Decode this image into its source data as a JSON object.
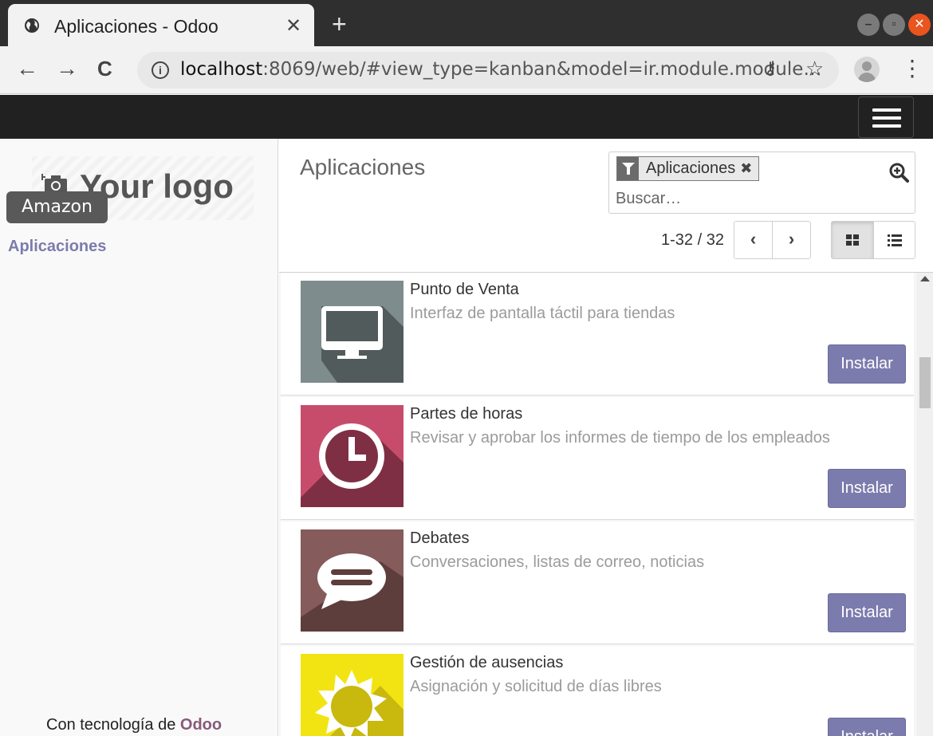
{
  "browser": {
    "tab_title": "Aplicaciones - Odoo",
    "tab_close": "✕",
    "new_tab": "+",
    "url_host": "localhost",
    "url_rest": ":8069/web/#view_type=kanban&model=ir.module.module…",
    "back": "←",
    "forward": "→",
    "reload": "C",
    "info": "i",
    "key": "⚷",
    "star": "☆",
    "menu": "⋮",
    "win_min": "–",
    "win_max": "▫",
    "win_close": "✕"
  },
  "sidebar": {
    "logo_text": "Your logo",
    "company_badge": "Amazon",
    "menu_item": "Aplicaciones",
    "powered_prefix": "Con tecnología de ",
    "powered_brand": "Odoo"
  },
  "control_panel": {
    "breadcrumb": "Aplicaciones",
    "facet_label": "Aplicaciones",
    "facet_close": "✖",
    "search_placeholder": "Buscar…",
    "pager_value": "1-32 / 32",
    "pager_prev": "‹",
    "pager_next": "›"
  },
  "apps": [
    {
      "name": "Punto de Venta",
      "summary": "Interfaz de pantalla táctil para tiendas",
      "button": "Instalar",
      "icon": "monitor-icon",
      "color": "#7f8c8d"
    },
    {
      "name": "Partes de horas",
      "summary": "Revisar y aprobar los informes de tiempo de los empleados",
      "button": "Instalar",
      "icon": "clock-icon",
      "color": "#c74c6c"
    },
    {
      "name": "Debates",
      "summary": "Conversaciones, listas de correo, noticias",
      "button": "Instalar",
      "icon": "chat-bubble-icon",
      "color": "#865b5b"
    },
    {
      "name": "Gestión de ausencias",
      "summary": "Asignación y solicitud de días libres",
      "button": "Instalar",
      "icon": "sun-icon",
      "color": "#f2e413"
    }
  ],
  "colors": {
    "odoo_primary": "#7c7bad",
    "odoo_brand": "#875a7b",
    "topbar": "#212121"
  }
}
